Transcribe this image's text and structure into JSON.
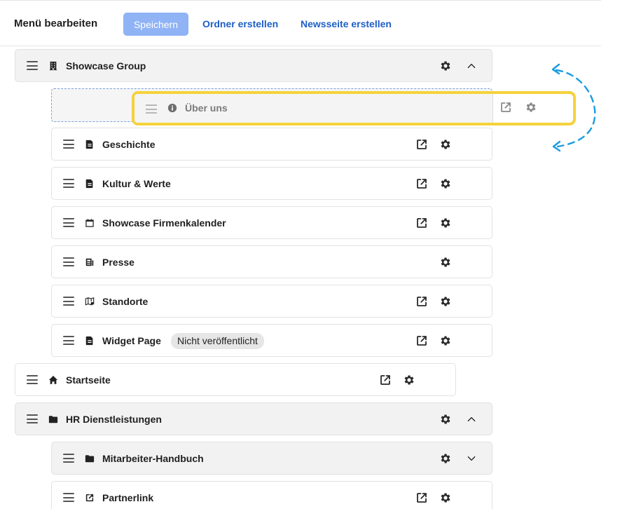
{
  "toolbar": {
    "title": "Menü bearbeiten",
    "save_label": "Speichern",
    "create_folder_label": "Ordner erstellen",
    "create_news_label": "Newsseite erstellen"
  },
  "dragging_item": {
    "label": "Über uns",
    "icon": "info-circle-icon"
  },
  "menu": {
    "showcase_group": {
      "label": "Showcase Group",
      "icon": "building-icon",
      "expanded": true
    },
    "geschichte": {
      "label": "Geschichte",
      "icon": "page-icon"
    },
    "kultur": {
      "label": "Kultur & Werte",
      "icon": "page-icon"
    },
    "kalender": {
      "label": "Showcase Firmenkalender",
      "icon": "calendar-icon"
    },
    "presse": {
      "label": "Presse",
      "icon": "newspaper-icon"
    },
    "standorte": {
      "label": "Standorte",
      "icon": "map-icon"
    },
    "widget": {
      "label": "Widget Page",
      "icon": "page-icon",
      "badge": "Nicht veröffentlicht"
    },
    "startseite": {
      "label": "Startseite",
      "icon": "home-icon"
    },
    "hr": {
      "label": "HR Dienstleistungen",
      "icon": "folder-icon",
      "expanded": true
    },
    "handbuch": {
      "label": "Mitarbeiter-Handbuch",
      "icon": "folder-icon",
      "expanded": false
    },
    "partnerlink": {
      "label": "Partnerlink",
      "icon": "external-link-icon"
    }
  },
  "colors": {
    "accent": "#1e5fc6",
    "save_button_bg": "#8fb3f5",
    "drag_highlight": "#f5d23c",
    "hint_arrow": "#1a9be0"
  }
}
